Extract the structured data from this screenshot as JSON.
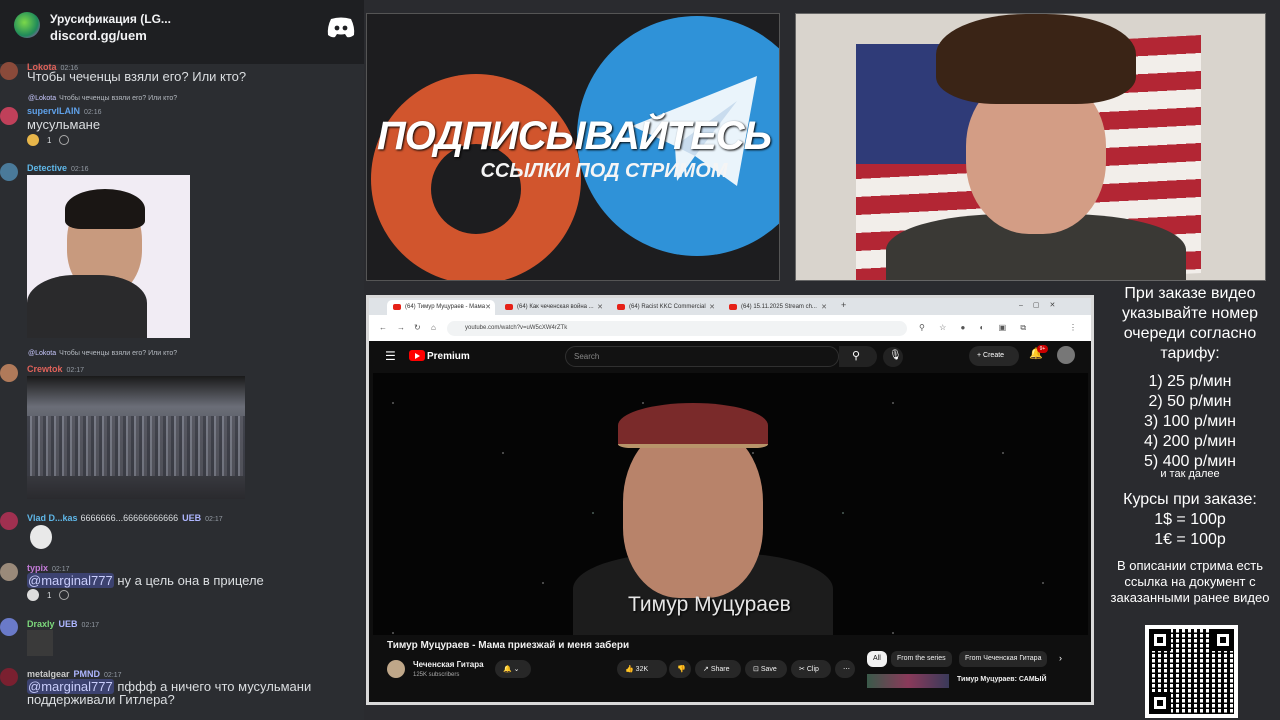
{
  "discord": {
    "server_title": "Урусификация (LG...",
    "server_link": "discord.gg/uem",
    "messages": [
      {
        "user": "Lokota",
        "time": "02:16",
        "text": "Чтобы чеченцы взяли его? Или кто?"
      },
      {
        "reply_user": "@Lokota",
        "reply_text": "Чтобы чеченцы взяли его? Или кто?",
        "user": "supervILAIN",
        "time": "02:16",
        "text": "мусульмане",
        "reactions": [
          "1"
        ]
      },
      {
        "user": "Detective",
        "time": "02:16"
      },
      {
        "reply_user": "@Lokota",
        "reply_text": "Чтобы чеченцы взяли его? Или кто?",
        "user": "Crewtok",
        "time": "02:17"
      },
      {
        "user": "Vlad D...kas",
        "extra": "6666666...66666666666",
        "tag": "UEB",
        "time": "02:17"
      },
      {
        "user": "typix",
        "time": "02:17",
        "mention": "@marginal777",
        "text": " ну а цель она в прицеле",
        "reactions": [
          "1"
        ]
      },
      {
        "user": "Draxly",
        "tag": "UEB",
        "time": "02:17"
      },
      {
        "user": "metalgear",
        "tag": "PMND",
        "time": "02:17",
        "mention": "@marginal777",
        "text": " пффф а ничего что мусульмани",
        "text2": "поддерживали Гитлера?"
      }
    ]
  },
  "promo": {
    "title": "ПОДПИСЫВАЙТЕСЬ",
    "subtitle": "ССЫЛКИ ПОД СТРИМОМ"
  },
  "browser": {
    "tabs": [
      {
        "label": "(64) Тимур Муцураев - Мама"
      },
      {
        "label": "(64) Как чеченская война ..."
      },
      {
        "label": "(64) Racist KKC Commercial"
      },
      {
        "label": "(64) 15.11.2025 Stream ch..."
      }
    ],
    "url": "youtube.com/watch?v=uW5cXW4rZTk",
    "yt": {
      "brand": "Premium",
      "search_placeholder": "Search",
      "create_label": "Create",
      "notif_count": "9+",
      "video_caption": "Тимур Муцураев",
      "video_title": "Тимур Муцураев - Мама приезжай и меня забери",
      "channel_name": "Чеченская Гитара",
      "channel_subs": "125K subscribers",
      "likes": "32K",
      "share": "Share",
      "save": "Save",
      "clip": "Clip",
      "chips": [
        "All",
        "From the series",
        "From Чеченская Гитара"
      ],
      "rec_title": "Тимур Муцураев: САМЫЙ"
    }
  },
  "info": {
    "intro": "При заказе видео указывайте номер очереди согласно тарифу:",
    "prices": [
      "1) 25 р/мин",
      "2) 50 р/мин",
      "3) 100 р/мин",
      "4) 200 р/мин",
      "5) 400 р/мин"
    ],
    "etc": "и так далее",
    "courses_title": "Курсы при заказе:",
    "courses": [
      "1$ = 100р",
      "1€ = 100р"
    ],
    "doc_note": "В описании стрима есть ссылка на документ с заказанными ранее видео"
  }
}
